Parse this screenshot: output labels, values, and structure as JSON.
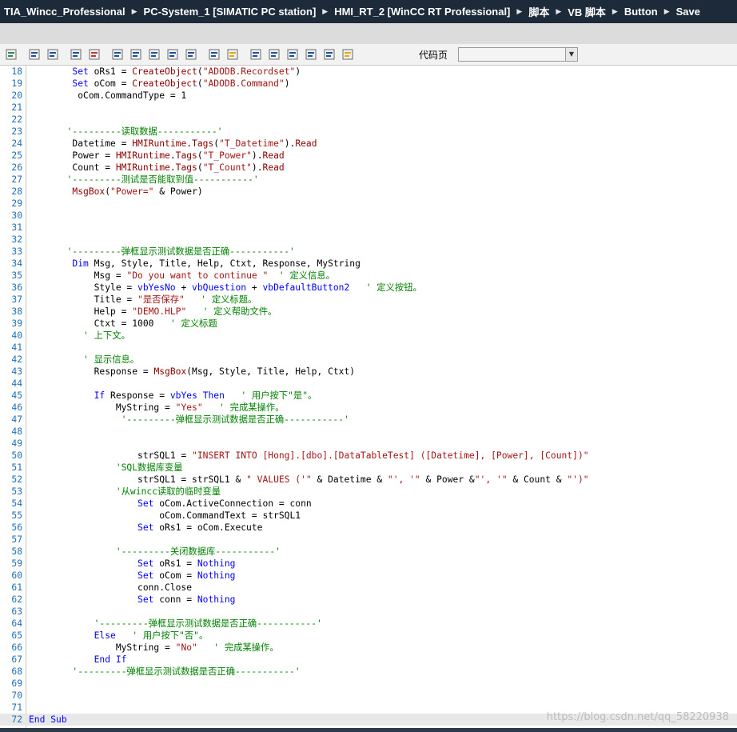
{
  "breadcrumb": [
    "TIA_Wincc_Professional",
    "PC-System_1 [SIMATIC PC station]",
    "HMI_RT_2 [WinCC RT Professional]",
    "脚本",
    "VB 脚本",
    "Button",
    "Save"
  ],
  "toolbar": {
    "icons": [
      "check-syntax-icon",
      "indent-icon",
      "outdent-icon",
      "list-icon",
      "jump-icon",
      "bookmark-icon",
      "prev-bookmark-icon",
      "next-bookmark-icon",
      "clear-bookmarks-icon",
      "comment-icon",
      "find-icon",
      "highlight-icon",
      "table-icon",
      "export-icon",
      "import-icon",
      "format-icon",
      "copy-icon",
      "settings-icon"
    ],
    "codepage_label": "代码页",
    "codepage_value": ""
  },
  "code_lines": [
    {
      "n": "18",
      "t": "        Set oRs1 = CreateObject(\"ADODB.Recordset\")"
    },
    {
      "n": "19",
      "t": "        Set oCom = CreateObject(\"ADODB.Command\")"
    },
    {
      "n": "20",
      "t": "         oCom.CommandType = 1"
    },
    {
      "n": "21",
      "t": ""
    },
    {
      "n": "22",
      "t": ""
    },
    {
      "n": "23",
      "t": "       '---------读取数据-----------'"
    },
    {
      "n": "24",
      "t": "        Datetime = HMIRuntime.Tags(\"T_Datetime\").Read"
    },
    {
      "n": "25",
      "t": "        Power = HMIRuntime.Tags(\"T_Power\").Read"
    },
    {
      "n": "26",
      "t": "        Count = HMIRuntime.Tags(\"T_Count\").Read"
    },
    {
      "n": "27",
      "t": "       '---------测试是否能取到值-----------'"
    },
    {
      "n": "28",
      "t": "        MsgBox(\"Power=\" & Power)"
    },
    {
      "n": "29",
      "t": ""
    },
    {
      "n": "30",
      "t": ""
    },
    {
      "n": "31",
      "t": ""
    },
    {
      "n": "32",
      "t": ""
    },
    {
      "n": "33",
      "t": "       '---------弹框显示测试数据是否正确-----------'"
    },
    {
      "n": "34",
      "t": "        Dim Msg, Style, Title, Help, Ctxt, Response, MyString"
    },
    {
      "n": "35",
      "t": "            Msg = \"Do you want to continue \"  ' 定义信息。"
    },
    {
      "n": "36",
      "t": "            Style = vbYesNo + vbQuestion + vbDefaultButton2   ' 定义按钮。"
    },
    {
      "n": "37",
      "t": "            Title = \"是否保存\"   ' 定义标题。"
    },
    {
      "n": "38",
      "t": "            Help = \"DEMO.HLP\"   ' 定义帮助文件。"
    },
    {
      "n": "39",
      "t": "            Ctxt = 1000   ' 定义标题"
    },
    {
      "n": "40",
      "t": "          ' 上下文。"
    },
    {
      "n": "41",
      "t": ""
    },
    {
      "n": "42",
      "t": "          ' 显示信息。"
    },
    {
      "n": "43",
      "t": "            Response = MsgBox(Msg, Style, Title, Help, Ctxt)"
    },
    {
      "n": "44",
      "t": ""
    },
    {
      "n": "45",
      "t": "            If Response = vbYes Then   ' 用户按下\"是\"。"
    },
    {
      "n": "46",
      "t": "                MyString = \"Yes\"   ' 完成某操作。"
    },
    {
      "n": "47",
      "t": "                 '---------弹框显示测试数据是否正确-----------'"
    },
    {
      "n": "48",
      "t": ""
    },
    {
      "n": "49",
      "t": ""
    },
    {
      "n": "50",
      "t": "                    strSQL1 = \"INSERT INTO [Hong].[dbo].[DataTableTest] ([Datetime], [Power], [Count])\""
    },
    {
      "n": "51",
      "t": "                'SQL数据库变量"
    },
    {
      "n": "52",
      "t": "                    strSQL1 = strSQL1 & \" VALUES ('\" & Datetime & \"', '\" & Power &\"', '\" & Count & \"')\""
    },
    {
      "n": "53",
      "t": "                '从wincc读取的临时变量"
    },
    {
      "n": "54",
      "t": "                    Set oCom.ActiveConnection = conn"
    },
    {
      "n": "55",
      "t": "                        oCom.CommandText = strSQL1"
    },
    {
      "n": "56",
      "t": "                    Set oRs1 = oCom.Execute"
    },
    {
      "n": "57",
      "t": ""
    },
    {
      "n": "58",
      "t": "                '---------关闭数据库-----------'"
    },
    {
      "n": "59",
      "t": "                    Set oRs1 = Nothing"
    },
    {
      "n": "60",
      "t": "                    Set oCom = Nothing"
    },
    {
      "n": "61",
      "t": "                    conn.Close"
    },
    {
      "n": "62",
      "t": "                    Set conn = Nothing"
    },
    {
      "n": "63",
      "t": ""
    },
    {
      "n": "64",
      "t": "            '---------弹框显示测试数据是否正确-----------'"
    },
    {
      "n": "65",
      "t": "            Else   ' 用户按下\"否\"。"
    },
    {
      "n": "66",
      "t": "                MyString = \"No\"   ' 完成某操作。"
    },
    {
      "n": "67",
      "t": "            End If"
    },
    {
      "n": "68",
      "t": "        '---------弹框显示测试数据是否正确-----------'"
    },
    {
      "n": "69",
      "t": ""
    },
    {
      "n": "70",
      "t": ""
    },
    {
      "n": "71",
      "t": ""
    },
    {
      "n": "72",
      "t": "End Sub"
    }
  ],
  "current_line": "72",
  "watermark": "https://blog.csdn.net/qq_58220938"
}
